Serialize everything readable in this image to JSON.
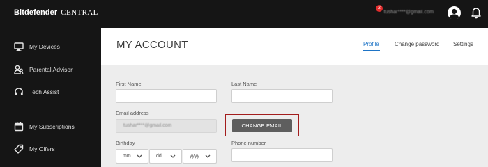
{
  "brand": {
    "name": "Bitdefender",
    "suffix": "CENTRAL"
  },
  "sidebar": {
    "items": [
      {
        "label": "My Devices",
        "icon": "monitor-icon"
      },
      {
        "label": "Parental Advisor",
        "icon": "parental-advisor-icon"
      },
      {
        "label": "Tech Assist",
        "icon": "headset-icon"
      },
      {
        "label": "My Subscriptions",
        "icon": "calendar-icon"
      },
      {
        "label": "My Offers",
        "icon": "tag-icon"
      }
    ]
  },
  "topbar": {
    "user_email": "tushar****@gmail.com",
    "notifications_count": "2",
    "icons": [
      "avatar-icon",
      "bell-icon"
    ]
  },
  "header": {
    "title": "MY ACCOUNT",
    "tabs": [
      {
        "label": "Profile",
        "active": true
      },
      {
        "label": "Change password",
        "active": false
      },
      {
        "label": "Settings",
        "active": false
      }
    ]
  },
  "form": {
    "first_name": {
      "label": "First Name",
      "value": ""
    },
    "last_name": {
      "label": "Last Name",
      "value": ""
    },
    "email": {
      "label": "Email address",
      "value": "tushar****@gmail.com"
    },
    "change_email_button": "CHANGE EMAIL",
    "birthday": {
      "label": "Birthday",
      "month": "mm",
      "day": "dd",
      "year": "yyyy"
    },
    "phone": {
      "label": "Phone number",
      "value": ""
    }
  },
  "colors": {
    "sidebar_bg": "#151515",
    "accent": "#1e74c6",
    "button_bg": "#5e5e5e",
    "highlight": "#a31d1d",
    "badge": "#e22c2c"
  }
}
